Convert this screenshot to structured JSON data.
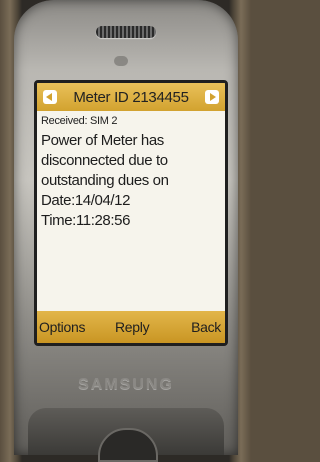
{
  "screen": {
    "title": "Meter ID 2134455",
    "received": "Received: SIM 2",
    "message": "Power of Meter has disconnected due to outstanding dues on Date:14/04/12 Time:11:28:56",
    "softkeys": {
      "left": "Options",
      "center": "Reply",
      "right": "Back"
    },
    "icons": {
      "left": "left-arrow-icon",
      "right": "right-arrow-icon"
    }
  },
  "device": {
    "brand": "SAMSUNG"
  },
  "colors": {
    "accent": "#d2a22f",
    "screen_bg": "#f6f4ec"
  }
}
